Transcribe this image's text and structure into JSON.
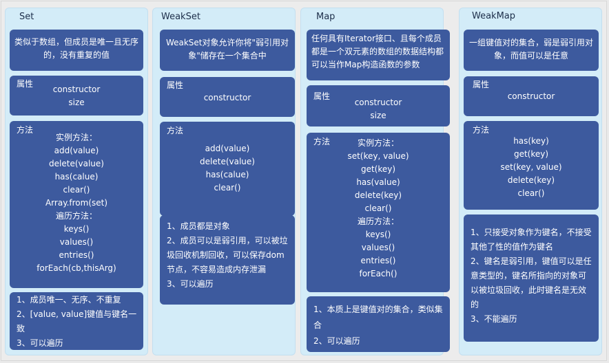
{
  "columns": [
    {
      "title": "Set",
      "description": "类似于数组，但成员是唯一且无序的，没有重复的值",
      "properties_title": "属性",
      "properties": [
        "constructor",
        "size"
      ],
      "methods_title": "方法",
      "methods": [
        "实例方法：",
        "add(value)",
        "delete(value)",
        "has(calue)",
        "clear()",
        "Array.from(set)",
        "遍历方法：",
        "keys()",
        "values()",
        "entries()",
        "forEach(cb,thisArg)"
      ],
      "notes": [
        "1、成员唯一、无序、不重复",
        "2、[value, value]键值与键名一致",
        "3、可以遍历"
      ]
    },
    {
      "title": "WeakSet",
      "description": "WeakSet对象允许你将\"弱引用对象\"储存在一个集合中",
      "properties_title": "属性",
      "properties": [
        "constructor"
      ],
      "methods_title": "方法",
      "methods": [
        "add(value)",
        "delete(value)",
        "has(calue)",
        "clear()"
      ],
      "notes": [
        "1、成员都是对象",
        "2、成员可以是弱引用，可以被垃圾回收机制回收，可以保存dom节点，不容易造成内存泄漏",
        "3、可以遍历"
      ]
    },
    {
      "title": "Map",
      "description": "任何具有Iterator接口、且每个成员都是一个双元素的数组的数据结构都可以当作Map构造函数的参数",
      "properties_title": "属性",
      "properties": [
        "constructor",
        "size"
      ],
      "methods_title": "方法",
      "methods": [
        "实例方法：",
        "set(key, value)",
        "get(key)",
        "has(value)",
        "delete(key)",
        "clear()",
        "遍历方法：",
        "keys()",
        "values()",
        "entries()",
        "forEach()"
      ],
      "notes": [
        "1、本质上是键值对的集合，类似集合",
        "2、可以遍历"
      ]
    },
    {
      "title": "WeakMap",
      "description": "一组键值对的集合，弱是弱引用对象，而值可以是任意",
      "properties_title": "属性",
      "properties": [
        "constructor"
      ],
      "methods_title": "方法",
      "methods": [
        "has(key)",
        "get(key)",
        "set(key, value)",
        "delete(key)",
        "clear()"
      ],
      "notes": [
        "1、只接受对象作为键名，不接受其他了性的值作为键名",
        "2、键名是弱引用，键值可以是任意类型的，键名所指向的对象可以被垃圾回收，此时键名是无效的",
        "3、不能遍历"
      ]
    }
  ],
  "colors": {
    "column_bg": "#d3ecf8",
    "box_bg": "#3d5a9e",
    "box_text": "#ffffff",
    "title_text": "#1d2e4a"
  }
}
